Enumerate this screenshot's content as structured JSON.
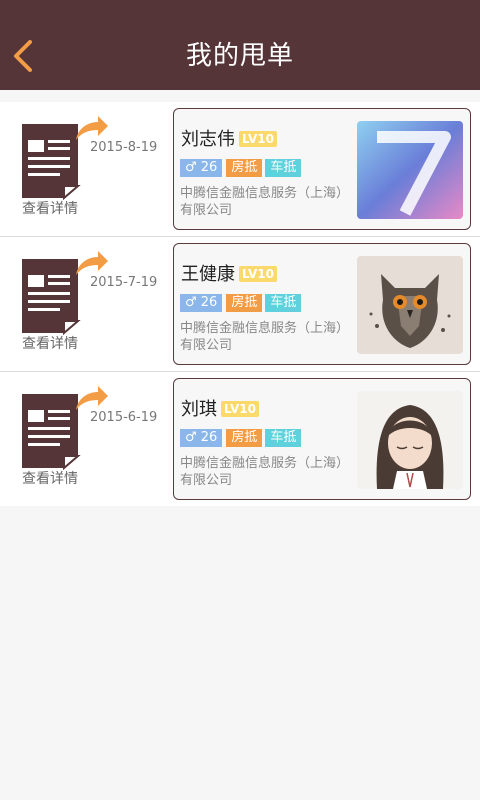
{
  "header": {
    "title": "我的甩单",
    "back_icon": "chevron-left-icon"
  },
  "colors": {
    "header_bg": "#553538",
    "accent_orange": "#f29c46",
    "age_tag": "#8ab6ea",
    "car_tag": "#5fd1dc",
    "level_badge": "#fbd96a"
  },
  "items": [
    {
      "date": "2015-8-19",
      "detail_label": "查看详情",
      "name": "刘志伟",
      "level": "LV10",
      "age": "♂ 26",
      "tag_house": "房抵",
      "tag_car": "车抵",
      "company_line1": "中腾信金融信息服务（上海）",
      "company_line2": "有限公司",
      "avatar": "number-7-wallpaper"
    },
    {
      "date": "2015-7-19",
      "detail_label": "查看详情",
      "name": "王健康",
      "level": "LV10",
      "age": "♂ 26",
      "tag_house": "房抵",
      "tag_car": "车抵",
      "company_line1": "中腾信金融信息服务（上海）",
      "company_line2": "有限公司",
      "avatar": "owl-illustration"
    },
    {
      "date": "2015-6-19",
      "detail_label": "查看详情",
      "name": "刘琪",
      "level": "LV10",
      "age": "♂ 26",
      "tag_house": "房抵",
      "tag_car": "车抵",
      "company_line1": "中腾信金融信息服务（上海）",
      "company_line2": "有限公司",
      "avatar": "anime-girl-illustration"
    }
  ]
}
